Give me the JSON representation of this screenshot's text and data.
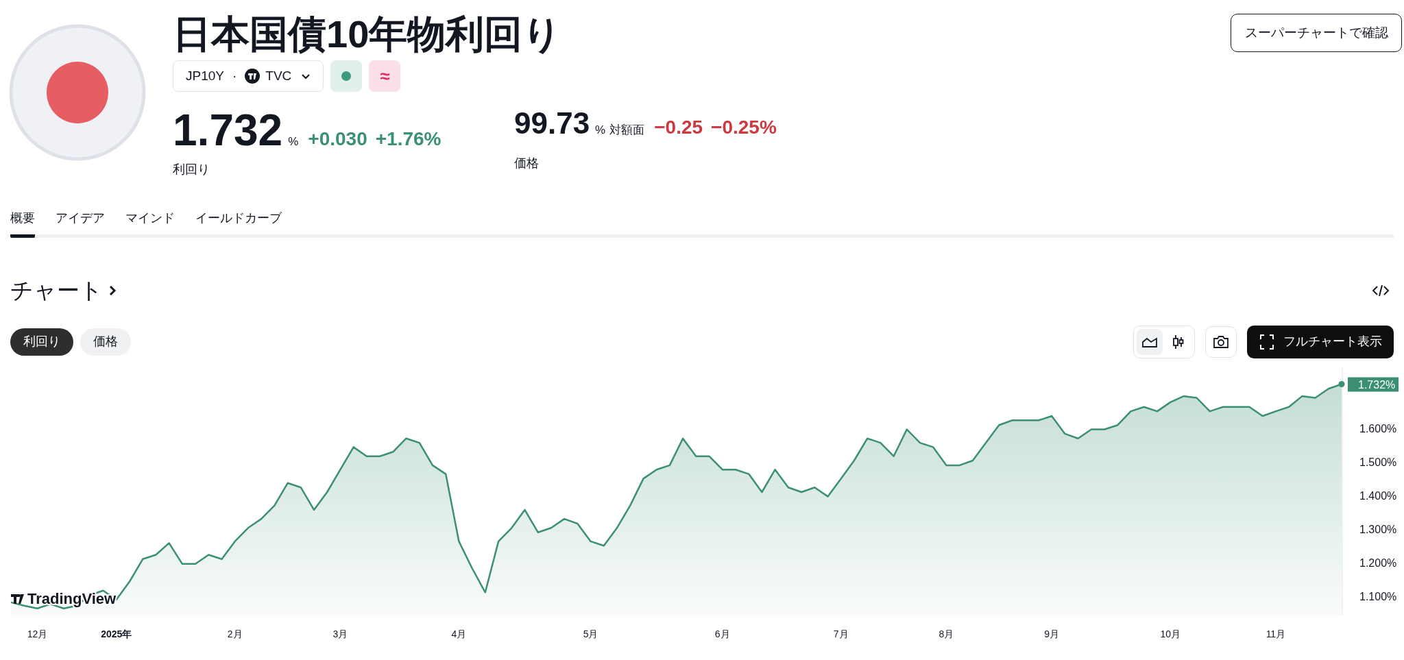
{
  "header": {
    "title": "日本国債10年物利回り",
    "symbol": "JP10Y",
    "separator": "·",
    "exchange": "TVC",
    "action_button": "スーパーチャートで確認"
  },
  "status_badges": [
    {
      "kind": "dot"
    },
    {
      "kind": "glyph",
      "text": "≈"
    }
  ],
  "quotes": [
    {
      "kind": "primary",
      "value": "1.732",
      "unit": "%",
      "change": "+0.030",
      "change_percent": "+1.76%",
      "label": "利回り",
      "color": "#3a8f75"
    },
    {
      "kind": "secondary",
      "value": "99.73",
      "unit": "%",
      "qualifier": "対額面",
      "change": "−0.25",
      "change_percent": "−0.25%",
      "label": "価格",
      "color": "#cc3a3f"
    }
  ],
  "tabs": [
    {
      "label": "概要",
      "selected": true
    },
    {
      "label": "アイデア",
      "selected": false
    },
    {
      "label": "マインド",
      "selected": false
    },
    {
      "label": "イールドカーブ",
      "selected": false
    }
  ],
  "chart_section": {
    "heading": "チャート",
    "series_toggle": [
      {
        "label": "利回り",
        "selected": true
      },
      {
        "label": "価格",
        "selected": false
      }
    ],
    "chart_styles": [
      {
        "kind": "area",
        "selected": true
      },
      {
        "kind": "candles",
        "selected": false
      }
    ],
    "full_chart_button": "フルチャート表示",
    "last_value_label": "1.732%",
    "logo_text": "TradingView",
    "chart_data": {
      "type": "area",
      "categories": [
        null,
        null,
        "12月",
        null,
        null,
        null,
        null,
        null,
        "2025年",
        null,
        null,
        null,
        null,
        null,
        null,
        null,
        null,
        "2月",
        null,
        null,
        null,
        null,
        null,
        null,
        null,
        "3月",
        null,
        null,
        null,
        null,
        null,
        null,
        null,
        null,
        "4月",
        null,
        null,
        null,
        null,
        null,
        null,
        null,
        null,
        null,
        "5月",
        null,
        null,
        null,
        null,
        null,
        null,
        null,
        null,
        null,
        "6月",
        null,
        null,
        null,
        null,
        null,
        null,
        null,
        null,
        "7月",
        null,
        null,
        null,
        null,
        null,
        null,
        null,
        "8月",
        null,
        null,
        null,
        null,
        null,
        null,
        null,
        "9月",
        null,
        null,
        null,
        null,
        null,
        null,
        null,
        null,
        "10月",
        null,
        null,
        null,
        null,
        null,
        null,
        null,
        "11月",
        null,
        null,
        null,
        null,
        null
      ],
      "series": [
        {
          "color": "#3b8f72",
          "values": [
            1.081,
            1.071,
            1.063,
            1.076,
            1.063,
            1.071,
            1.103,
            1.116,
            1.089,
            1.143,
            1.21,
            1.223,
            1.258,
            1.196,
            1.196,
            1.223,
            1.21,
            1.263,
            1.303,
            1.33,
            1.37,
            1.437,
            1.424,
            1.357,
            1.41,
            1.477,
            1.544,
            1.517,
            1.517,
            1.53,
            1.57,
            1.557,
            1.49,
            1.464,
            1.263,
            1.183,
            1.111,
            1.263,
            1.303,
            1.357,
            1.29,
            1.303,
            1.33,
            1.316,
            1.263,
            1.25,
            1.303,
            1.37,
            1.45,
            1.477,
            1.49,
            1.57,
            1.517,
            1.517,
            1.477,
            1.477,
            1.464,
            1.41,
            1.477,
            1.424,
            1.41,
            1.424,
            1.397,
            1.45,
            1.504,
            1.57,
            1.557,
            1.517,
            1.597,
            1.557,
            1.544,
            1.49,
            1.49,
            1.504,
            1.557,
            1.61,
            1.624,
            1.624,
            1.624,
            1.637,
            1.584,
            1.57,
            1.597,
            1.597,
            1.61,
            1.651,
            1.664,
            1.651,
            1.678,
            1.696,
            1.691,
            1.651,
            1.664,
            1.664,
            1.664,
            1.637,
            1.651,
            1.664,
            1.696,
            1.691,
            1.718,
            1.732
          ]
        }
      ],
      "ylim": [
        1.04,
        1.78
      ],
      "yticks": [
        {
          "value": 1.1,
          "label": "1.100%"
        },
        {
          "value": 1.2,
          "label": "1.200%"
        },
        {
          "value": 1.3,
          "label": "1.300%"
        },
        {
          "value": 1.4,
          "label": "1.400%"
        },
        {
          "value": 1.5,
          "label": "1.500%"
        },
        {
          "value": 1.6,
          "label": "1.600%"
        }
      ]
    }
  }
}
